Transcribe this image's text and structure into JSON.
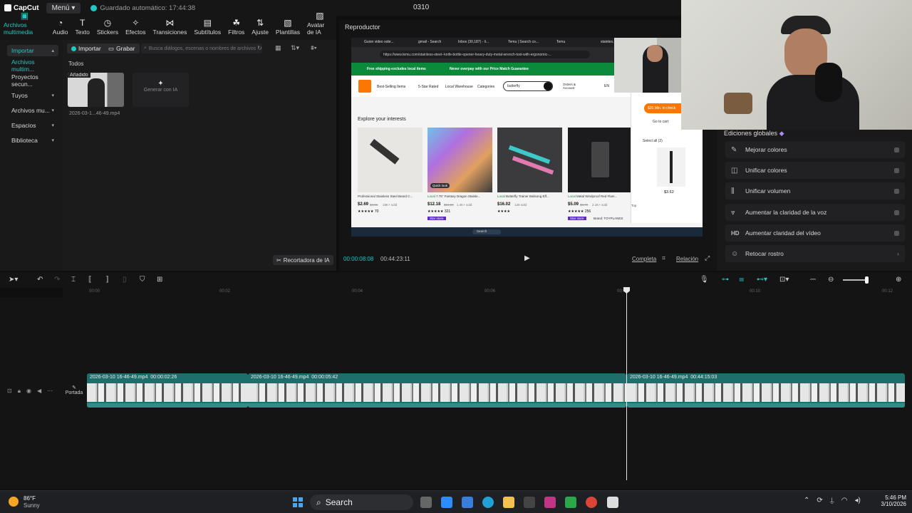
{
  "app": {
    "name": "CapCut",
    "menu_label": "Menú",
    "autosave": "Guardado automático: 17:44:38",
    "project_title": "0310"
  },
  "toolbar": {
    "items": [
      {
        "label": "Archivos multimedia",
        "icon": "media-icon"
      },
      {
        "label": "Audio",
        "icon": "audio-icon"
      },
      {
        "label": "Texto",
        "icon": "text-icon"
      },
      {
        "label": "Stickers",
        "icon": "sticker-icon"
      },
      {
        "label": "Efectos",
        "icon": "effects-icon"
      },
      {
        "label": "Transiciones",
        "icon": "transitions-icon"
      },
      {
        "label": "Subtítulos",
        "icon": "subtitles-icon"
      },
      {
        "label": "Filtros",
        "icon": "filters-icon"
      },
      {
        "label": "Ajuste",
        "icon": "adjust-icon"
      },
      {
        "label": "Plantillas",
        "icon": "templates-icon"
      },
      {
        "label": "Avatar de IA",
        "icon": "avatar-icon"
      }
    ]
  },
  "sidebar": {
    "items": [
      {
        "label": "Importar"
      },
      {
        "label": "Archivos multim..."
      },
      {
        "label": "Proyectos secun..."
      },
      {
        "label": "Tuyos"
      },
      {
        "label": "Archivos mu..."
      },
      {
        "label": "Espacios"
      },
      {
        "label": "Biblioteca"
      }
    ]
  },
  "media": {
    "import_label": "Importar",
    "record_label": "Grabar",
    "search_placeholder": "Busca diálogos, escenas o nombres de archivos",
    "filter_label": "Todos",
    "added_tag": "Añadido",
    "file_name": "2026-03-1...46-49.mp4",
    "generate_label": "Generar con IA",
    "ai_cutout_label": "Recortadora de IA"
  },
  "player": {
    "title": "Reproductor",
    "time_current": "00:00:08:08",
    "time_total": "00:44:23:11",
    "full_label": "Completa",
    "ratio_label": "Relación"
  },
  "browser": {
    "tabs": [
      "Guion video sobr...",
      "gmail - Search",
      "Inbox (30,187) - li...",
      "Temu | Search co...",
      "Temu",
      "stainles..."
    ],
    "url": "https://www.temu.com/stainless-steel--knife-bottle-opener-heavy-duty-metal-wrench-tool-with-ergonomic-...",
    "banner_left": "Free shipping excludes local items",
    "banner_right": "Never overpay with our Price Match Guarantee",
    "nav": [
      "Best-Selling Items",
      "5-Star Rated",
      "Local Warehouse",
      "Categories"
    ],
    "search_value": "butterfly",
    "orders": "Orders & Account",
    "lang": "EN",
    "heading": "Explore your interests",
    "products": [
      {
        "name": "Professional Stainless Steel Beard C...",
        "price": "$2.69",
        "old": "$4.96",
        "sold": "18K+ sold",
        "reviews": "70"
      },
      {
        "name": "7.75\" Fantasy Dragon Stainle...",
        "price": "$12.18",
        "old": "$34.99",
        "sold": "1.4K+ sold",
        "reviews": "321"
      },
      {
        "name": "Butterfly Trainer Balisong Eff...",
        "price": "$16.02",
        "old": "",
        "sold": "128 sold",
        "reviews": ""
      },
      {
        "name": "Metal Windproof Red Flam...",
        "price": "$5.09",
        "old": "$8.79",
        "sold": "2.1K+ sold",
        "reviews": "256"
      }
    ],
    "local_tag": "Local",
    "quick_look": "Quick look",
    "star_store": "Star store",
    "brand": "Brand: TOYPLANES",
    "cart_free": "Free shipping",
    "cart_btn": "$20 Min. to check",
    "go_cart": "Go to cart",
    "select_all": "Select all (2)",
    "cart_price": "$3.62",
    "top_label": "Top",
    "win_search": "Search"
  },
  "right_panel": {
    "title": "Ediciones globales",
    "items": [
      {
        "label": "Mejorar colores",
        "icon": "enhance-icon"
      },
      {
        "label": "Unificar colores",
        "icon": "unify-colors-icon"
      },
      {
        "label": "Unificar volumen",
        "icon": "volume-icon"
      },
      {
        "label": "Aumentar la claridad de la voz",
        "icon": "voice-icon"
      },
      {
        "label": "Aumentar claridad del vídeo",
        "icon": "hd-icon"
      },
      {
        "label": "Retocar rostro",
        "icon": "face-icon"
      }
    ]
  },
  "timeline": {
    "ruler": [
      "00:00",
      "00:02",
      "00:04",
      "00:06",
      "00:08",
      "00:10",
      "00:12"
    ],
    "cover_label": "Portada",
    "clips": [
      {
        "name": "2026-03-10 16-46-49.mp4",
        "duration": "00:00:02:26"
      },
      {
        "name": "2026-03-10 16-46-49.mp4",
        "duration": "00:00:05:42"
      },
      {
        "name": "2026-03-10 16-46-49.mp4",
        "duration": "00:44:15:03"
      }
    ]
  },
  "taskbar": {
    "weather_temp": "86°F",
    "weather_desc": "Sunny",
    "search": "Search",
    "time": "5:46 PM",
    "date": "3/10/2026"
  },
  "colors": {
    "accent": "#21c7c1",
    "clip": "#1e6f6b",
    "temu": "#fb7701"
  }
}
